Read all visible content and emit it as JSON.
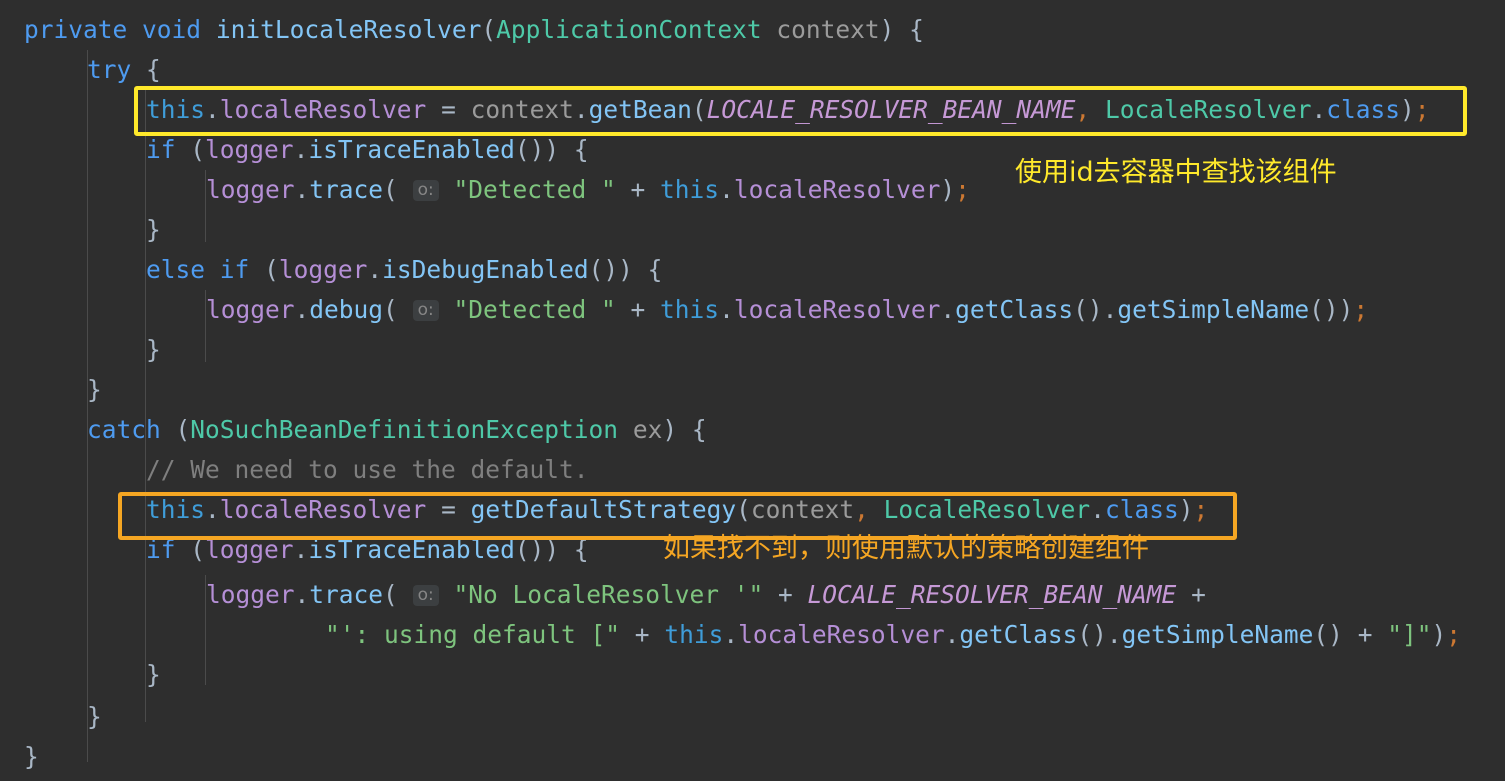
{
  "editor": {
    "background": "#2e2e2e",
    "default_text_color": "#a9b7c6",
    "indent_guide_color": "#4b4b4b",
    "language": "Java"
  },
  "palette": {
    "keyword": "#4e9bf0",
    "method": "#83c5f5",
    "field": "#b58fd6",
    "this_keyword": "#3f9dd9",
    "type": "#4ec9a8",
    "constant": "#c699d6",
    "string": "#7ec47e",
    "comment": "#7f7f7f",
    "punctuation": "#a9b7c6",
    "semicolon": "#cc7832",
    "parameter": "#9b9b9b",
    "hint_badge_bg": "#3c3f41",
    "hint_badge_text": "#868686",
    "highlight_yellow": "#ffe92b",
    "highlight_orange": "#f5a623"
  },
  "inlay_hints": {
    "trace_arg": "o:",
    "debug_arg": "o:",
    "trace_arg_2": "o:"
  },
  "code_lines": [
    {
      "n": 1,
      "indent": 0,
      "text": "private void initLocaleResolver(ApplicationContext context) {"
    },
    {
      "n": 2,
      "indent": 1,
      "text": "try {"
    },
    {
      "n": 3,
      "indent": 2,
      "text": "this.localeResolver = context.getBean(LOCALE_RESOLVER_BEAN_NAME, LocaleResolver.class);"
    },
    {
      "n": 4,
      "indent": 2,
      "text": "if (logger.isTraceEnabled()) {"
    },
    {
      "n": 5,
      "indent": 3,
      "text": "logger.trace( o: \"Detected \" + this.localeResolver);"
    },
    {
      "n": 6,
      "indent": 2,
      "text": "}"
    },
    {
      "n": 7,
      "indent": 2,
      "text": "else if (logger.isDebugEnabled()) {"
    },
    {
      "n": 8,
      "indent": 3,
      "text": "logger.debug( o: \"Detected \" + this.localeResolver.getClass().getSimpleName());"
    },
    {
      "n": 9,
      "indent": 2,
      "text": "}"
    },
    {
      "n": 10,
      "indent": 1,
      "text": "}"
    },
    {
      "n": 11,
      "indent": 1,
      "text": "catch (NoSuchBeanDefinitionException ex) {"
    },
    {
      "n": 12,
      "indent": 2,
      "text": "// We need to use the default."
    },
    {
      "n": 13,
      "indent": 2,
      "text": "this.localeResolver = getDefaultStrategy(context, LocaleResolver.class);"
    },
    {
      "n": 14,
      "indent": 2,
      "text": "if (logger.isTraceEnabled()) {"
    },
    {
      "n": 15,
      "indent": 3,
      "text": "logger.trace( o: \"No LocaleResolver '\" + LOCALE_RESOLVER_BEAN_NAME +"
    },
    {
      "n": 16,
      "indent": 4,
      "text": "\"': using default [\" + this.localeResolver.getClass().getSimpleName() + \"]\");"
    },
    {
      "n": 17,
      "indent": 3,
      "text": "}"
    },
    {
      "n": 18,
      "indent": 1,
      "text": "}"
    },
    {
      "n": 19,
      "indent": 0,
      "text": "}"
    }
  ],
  "annotations": {
    "boxes": [
      {
        "id": "highlight-getbean-line",
        "color": "#ffe92b",
        "target_line": 3,
        "label": "this.localeResolver = context.getBean(LOCALE_RESOLVER_BEAN_NAME, LocaleResolver.class);"
      },
      {
        "id": "highlight-default-strategy-line",
        "color": "#f5a623",
        "target_line": 13,
        "label": "this.localeResolver = getDefaultStrategy(context, LocaleResolver.class);"
      }
    ],
    "notes": [
      {
        "id": "note-lookup-by-id",
        "text": "使用id去容器中查找该组件",
        "color": "#ffe92b"
      },
      {
        "id": "note-default-strategy",
        "text": "如果找不到，则使用默认的策略创建组件",
        "color": "#f5a623"
      }
    ]
  }
}
